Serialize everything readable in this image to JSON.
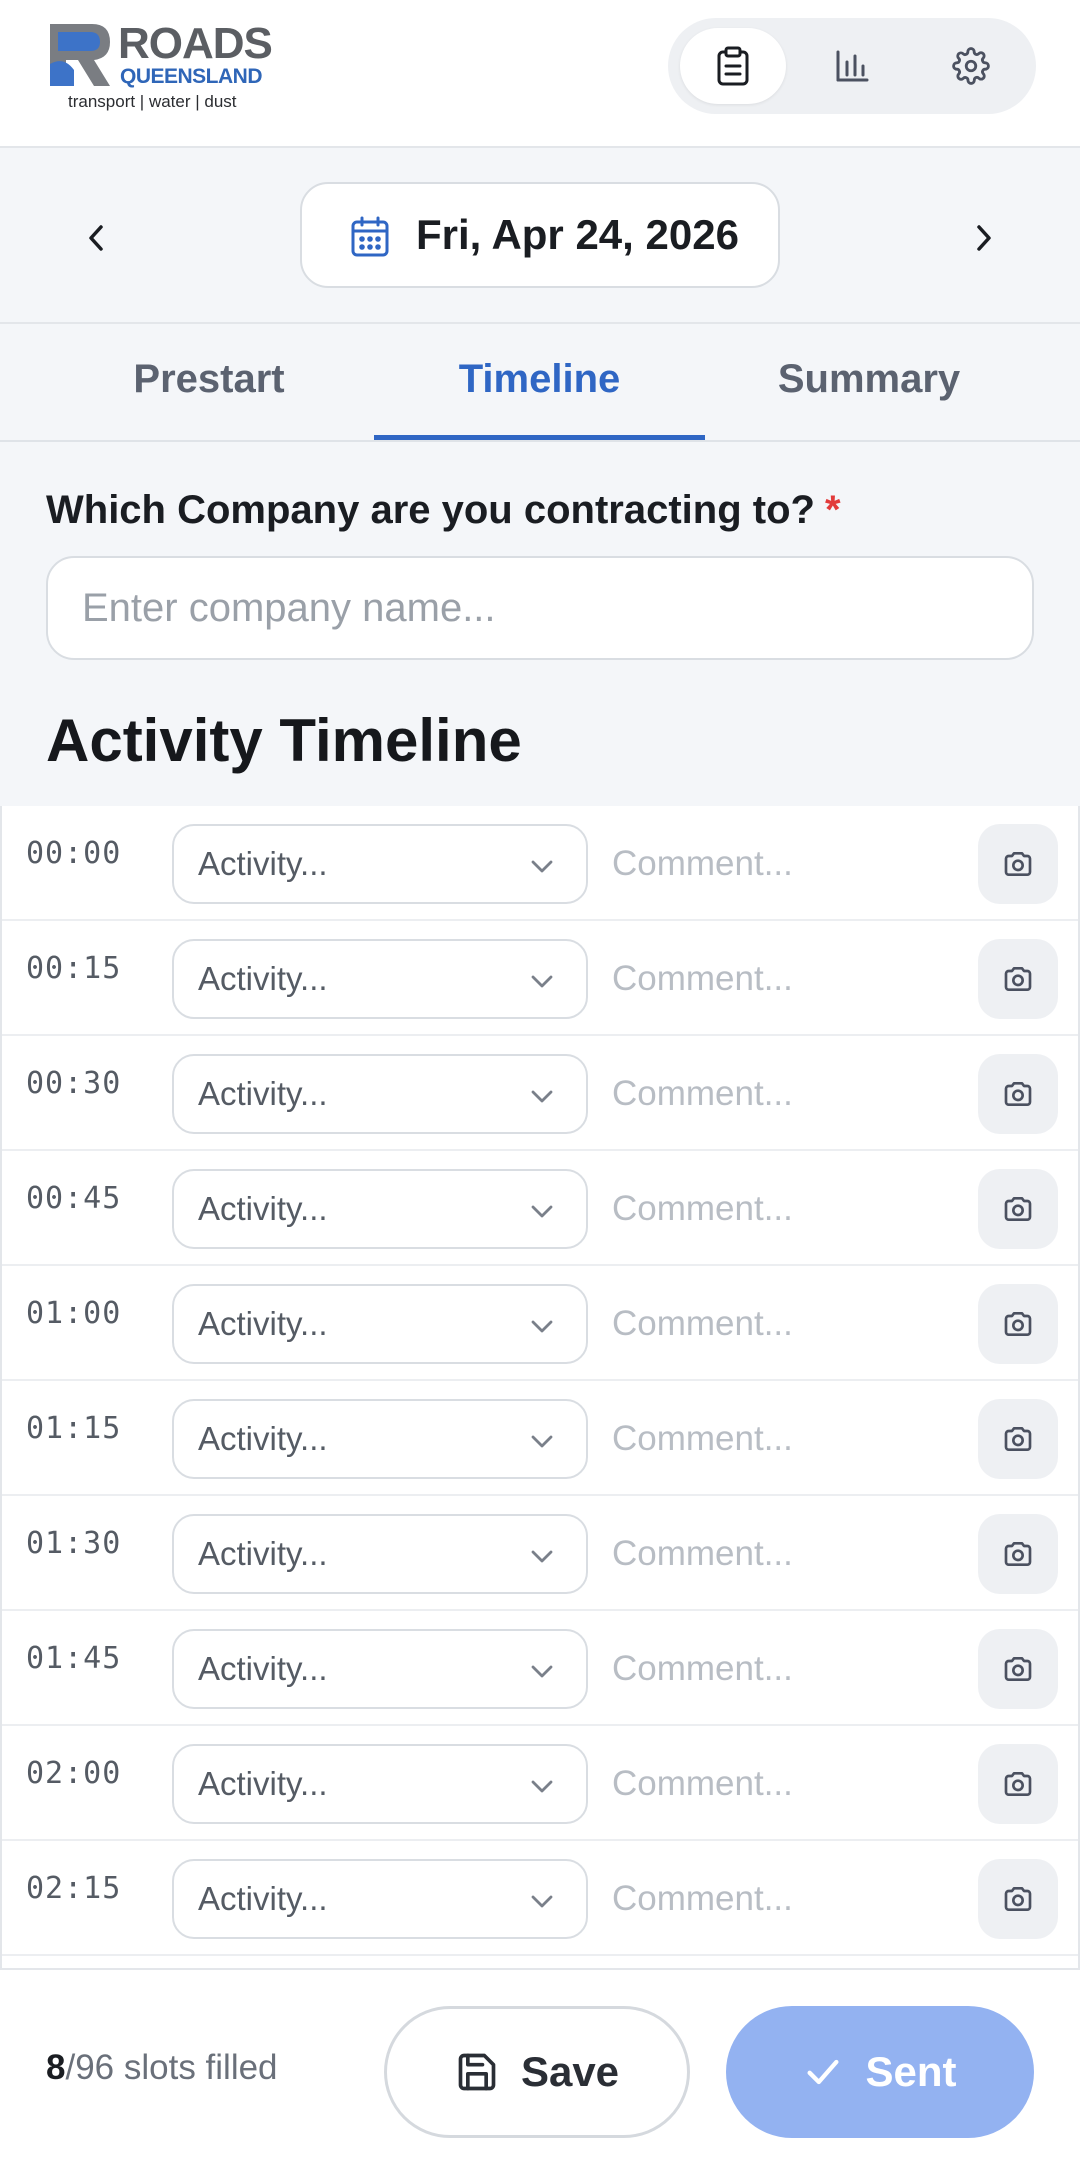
{
  "brand": {
    "name_line1": "ROADS",
    "name_line2": "QUEENSLAND",
    "tagline": "transport | water | dust",
    "logo_colors": {
      "grey": "#5b5e63",
      "blue": "#2f66b8"
    }
  },
  "header_nav": {
    "items": [
      {
        "icon": "clipboard-icon",
        "active": true
      },
      {
        "icon": "bar-chart-icon",
        "active": false
      },
      {
        "icon": "gear-icon",
        "active": false
      }
    ]
  },
  "datebar": {
    "date_label": "Fri, Apr 24, 2026",
    "prev_icon": "chevron-left-icon",
    "next_icon": "chevron-right-icon",
    "calendar_icon": "calendar-icon"
  },
  "tabs": {
    "items": [
      "Prestart",
      "Timeline",
      "Summary"
    ],
    "active": "Timeline",
    "accent_color": "#2f66c4"
  },
  "company": {
    "label": "Which Company are you contracting to?",
    "required_mark": "*",
    "placeholder": "Enter company name...",
    "value": ""
  },
  "timeline": {
    "title": "Activity Timeline",
    "activity_placeholder": "Activity...",
    "comment_placeholder": "Comment...",
    "rows": [
      {
        "time": "00:00"
      },
      {
        "time": "00:15"
      },
      {
        "time": "00:30"
      },
      {
        "time": "00:45"
      },
      {
        "time": "01:00"
      },
      {
        "time": "01:15"
      },
      {
        "time": "01:30"
      },
      {
        "time": "01:45"
      },
      {
        "time": "02:00"
      },
      {
        "time": "02:15"
      }
    ]
  },
  "footer": {
    "filled": "8",
    "total_text": "/96 slots filled",
    "save_label": "Save",
    "sent_label": "Sent",
    "sent_color": "#93b2f1"
  }
}
